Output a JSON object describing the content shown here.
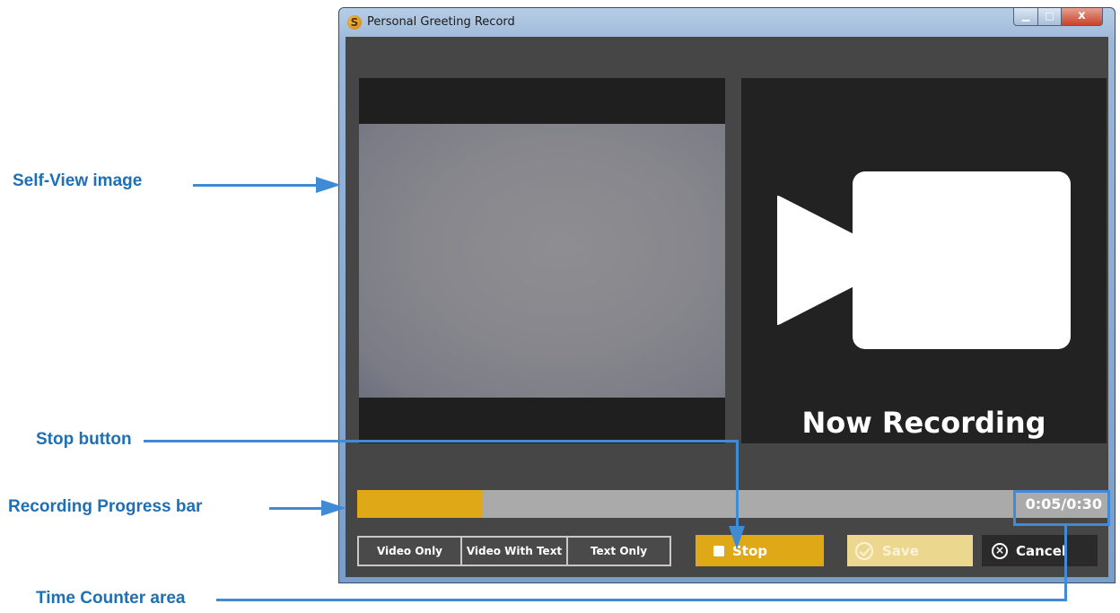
{
  "annotations": {
    "self_view": "Self-View image",
    "stop_button": "Stop button",
    "progress_bar": "Recording Progress bar",
    "time_counter": "Time Counter area"
  },
  "window": {
    "title": "Personal Greeting Record",
    "app_icon_letter": "S",
    "close_glyph": "x"
  },
  "preview": {
    "status_text": "Now Recording",
    "icon": "video-camera-icon"
  },
  "progress": {
    "fraction": 0.1667,
    "time_counter": "0:05/0:30",
    "fill_color": "#dfa816"
  },
  "modes": [
    {
      "label": "Video Only"
    },
    {
      "label": "Video With Text"
    },
    {
      "label": "Text Only"
    }
  ],
  "actions": {
    "stop_label": "Stop",
    "save_label": "Save",
    "cancel_label": "Cancel",
    "cancel_glyph": "×"
  }
}
